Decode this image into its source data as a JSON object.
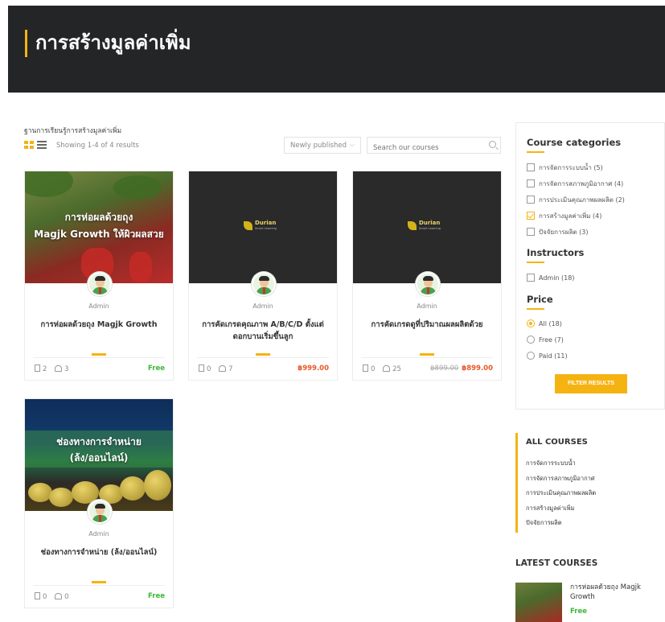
{
  "page": {
    "title": "การสร้างมูลค่าเพิ่ม"
  },
  "breadcrumb": "ฐานการเรียนรู้การสร้างมูลค่าเพิ่ม",
  "toolbar": {
    "result_count": "Showing 1-4 of 4 results",
    "sort_label": "Newly published",
    "search_placeholder": "Search our courses"
  },
  "courses": [
    {
      "thumb_text": [
        "การห่อผลด้วยถุง",
        "Magjk Growth ให้ผิวผลสวย"
      ],
      "instructor": "Admin",
      "title": "การห่อผลด้วยถุง Magjk Growth",
      "lessons": "2",
      "students": "3",
      "price": "Free"
    },
    {
      "logo_text": "Durian",
      "logo_sub": "Smart Learning",
      "instructor": "Admin",
      "title": "การคัดเกรดคุณภาพ A/B/C/D ตั้งแต่ดอกบานเริ่มขึ้นลูก",
      "lessons": "0",
      "students": "7",
      "price": "฿999.00"
    },
    {
      "logo_text": "Durian",
      "logo_sub": "Smart Learning",
      "instructor": "Admin",
      "title": "การคัดเกรดดูที่ปริมาณผลผลิตด้วย",
      "lessons": "0",
      "students": "25",
      "old_price": "฿899.00",
      "price": "฿899.00"
    },
    {
      "thumb_text": [
        "ช่องทางการจำหน่าย",
        "(ล้ง/ออนไลน์)"
      ],
      "instructor": "Admin",
      "title": "ช่องทางการจำหน่าย (ล้ง/ออนไลน์)",
      "lessons": "0",
      "students": "0",
      "price": "Free"
    }
  ],
  "sidebar": {
    "categories_title": "Course categories",
    "categories": [
      {
        "label": "การจัดการระบบน้ำ (5)",
        "checked": false
      },
      {
        "label": "การจัดการสภาพภูมิอากาศ (4)",
        "checked": false
      },
      {
        "label": "การประเมินคุณภาพผลผลิต (2)",
        "checked": false
      },
      {
        "label": "การสร้างมูลค่าเพิ่ม (4)",
        "checked": true
      },
      {
        "label": "ปัจจัยการผลิต (3)",
        "checked": false
      }
    ],
    "instructors_title": "Instructors",
    "instructors": [
      {
        "label": "Admin (18)",
        "checked": false
      }
    ],
    "price_title": "Price",
    "price_options": [
      {
        "label": "All (18)",
        "selected": true
      },
      {
        "label": "Free (7)",
        "selected": false
      },
      {
        "label": "Paid (11)",
        "selected": false
      }
    ],
    "filter_button": "FILTER RESULTS",
    "all_courses_title": "ALL COURSES",
    "all_courses": [
      "การจัดการระบบน้ำ",
      "การจัดการสภาพภูมิอากาศ",
      "การประเมินคุณภาพผลผลิต",
      "การสร้างมูลค่าเพิ่ม",
      "ปัจจัยการผลิต"
    ],
    "latest_title": "LATEST COURSES",
    "latest": {
      "name": "การห่อผลด้วยถุง Magjk Growth",
      "price": "Free"
    }
  },
  "colors": {
    "accent": "#f5b312",
    "hero_bg": "#232527",
    "free": "#3cb734",
    "paid": "#e8572a"
  }
}
